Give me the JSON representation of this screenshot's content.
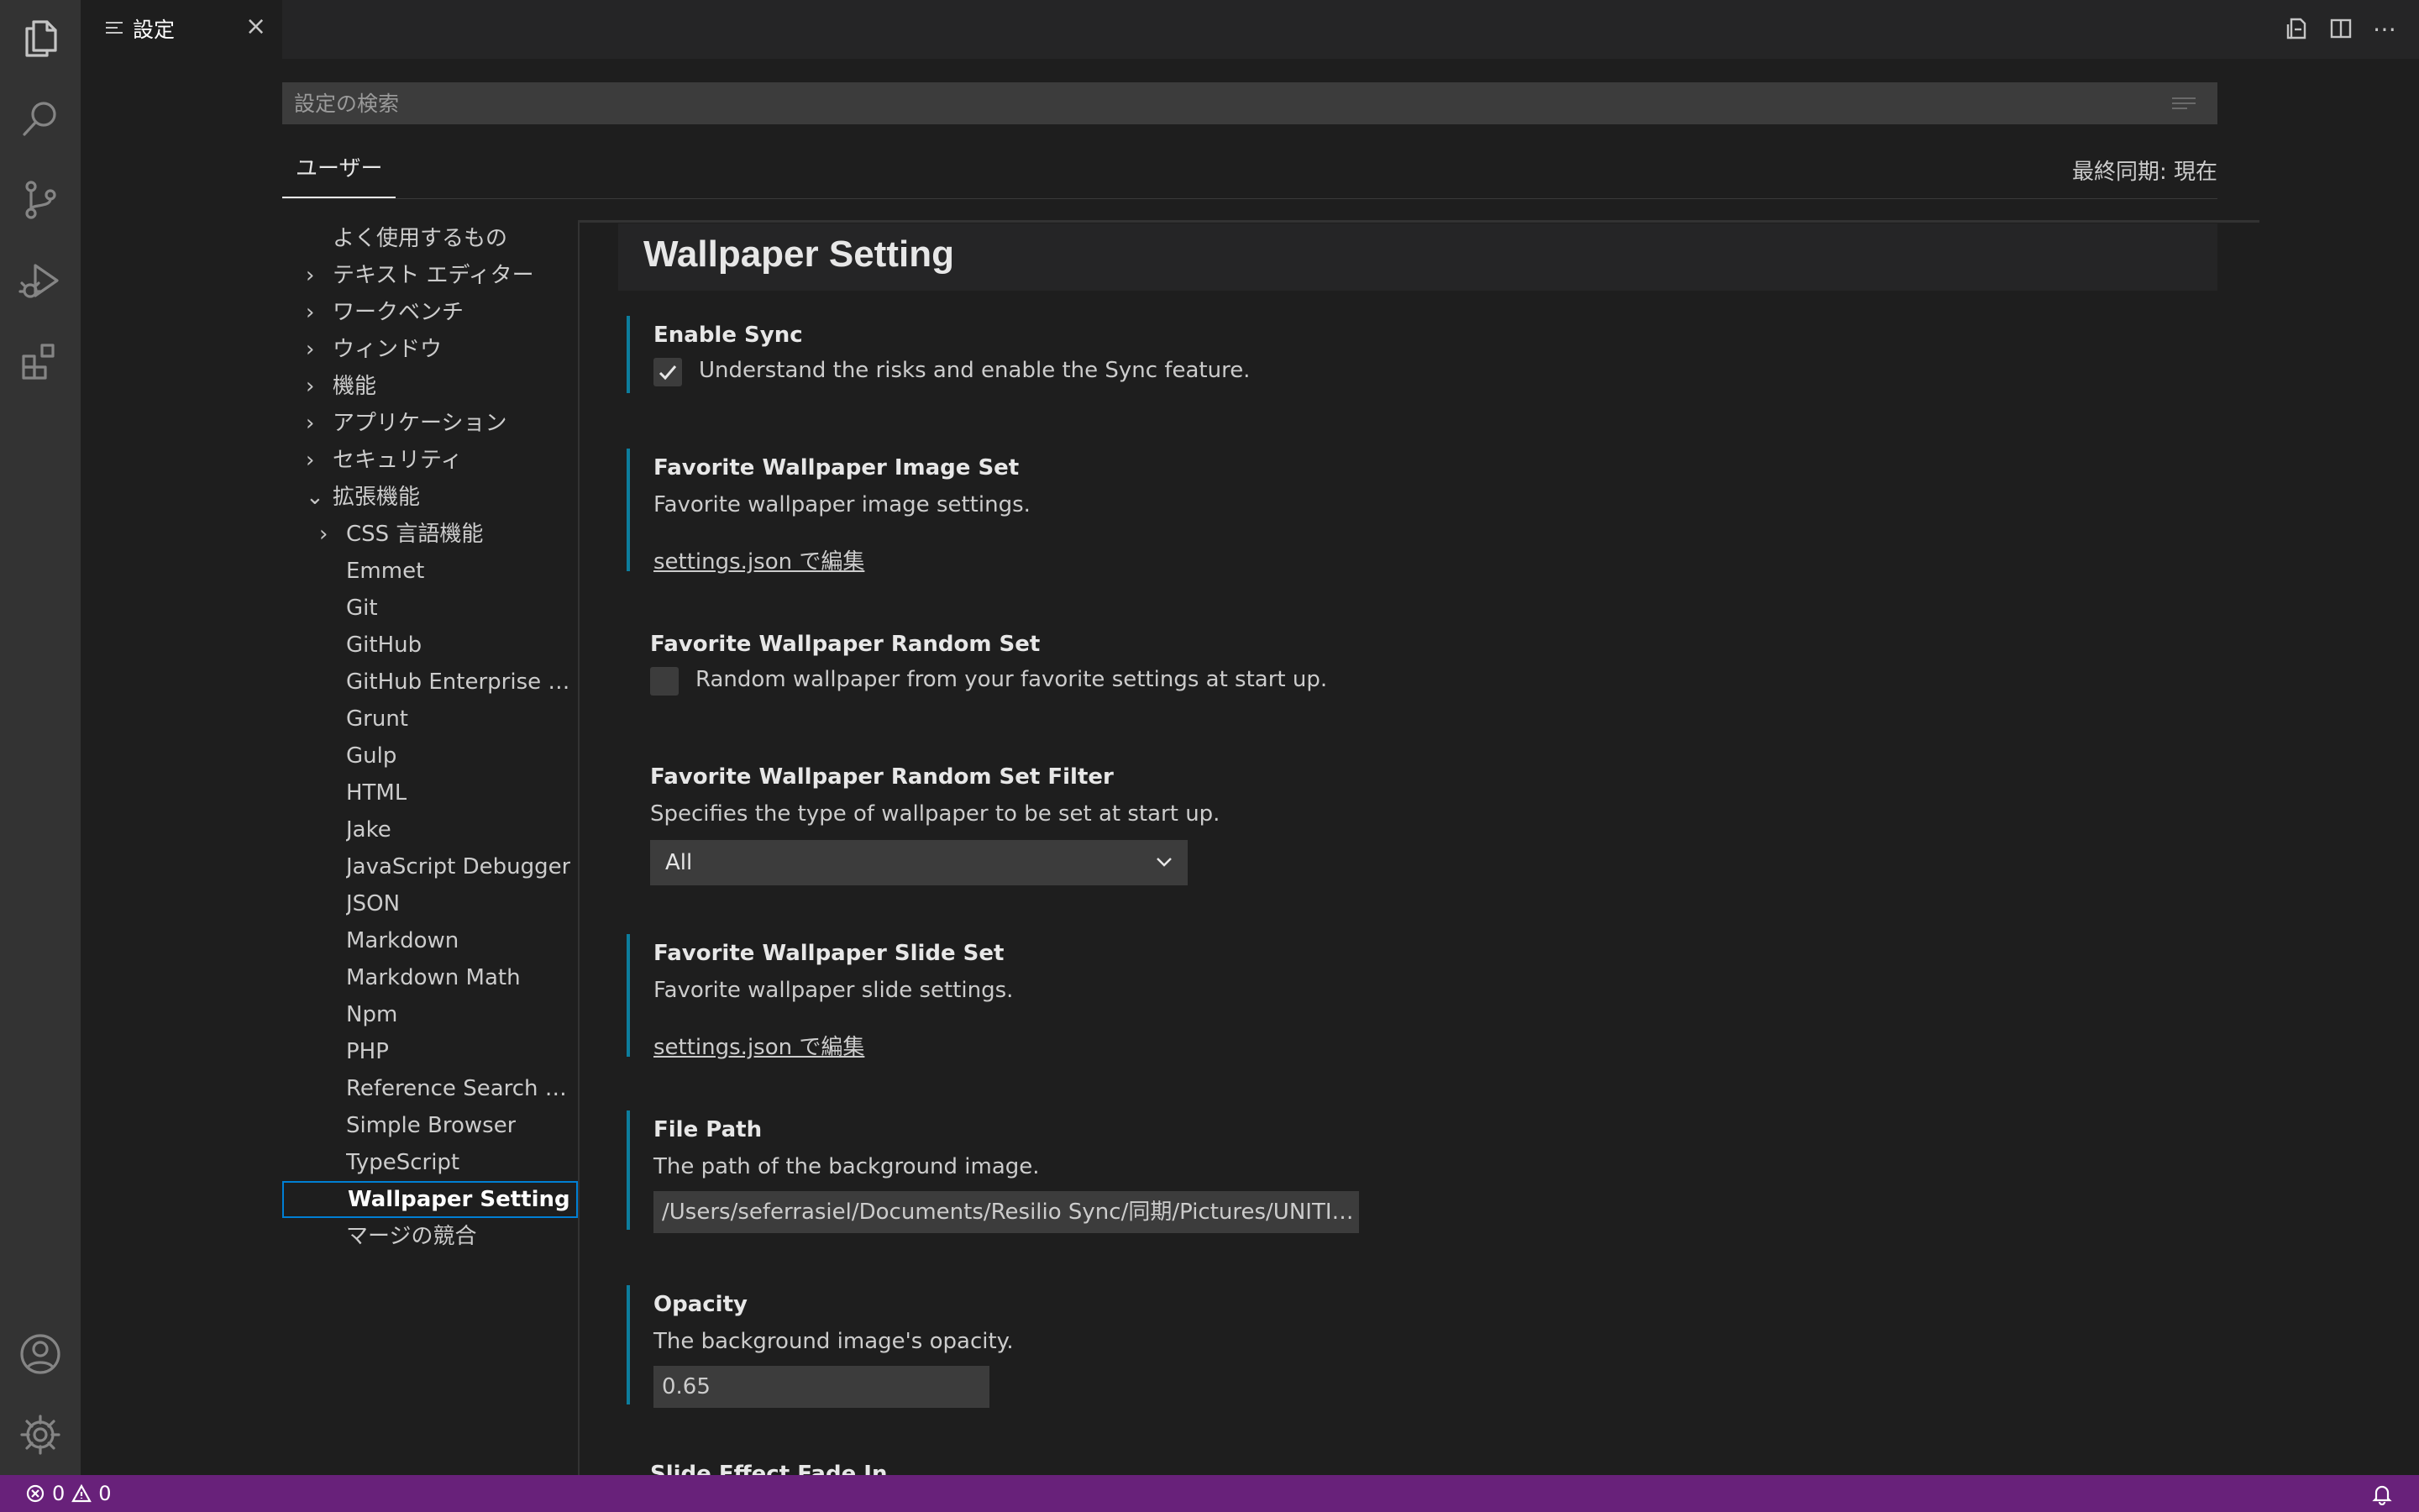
{
  "activity_bar": {
    "icons": [
      "explorer-icon",
      "search-icon",
      "source-control-icon",
      "run-debug-icon",
      "extensions-icon",
      "account-icon",
      "settings-gear-icon"
    ]
  },
  "tab": {
    "label": "設定",
    "close": "×"
  },
  "search": {
    "placeholder": "設定の検索"
  },
  "scope": {
    "user_tab": "ユーザー",
    "sync_status": "最終同期: 現在"
  },
  "toc": {
    "items": [
      {
        "label": "よく使用するもの",
        "chevron": ""
      },
      {
        "label": "テキスト エディター",
        "chevron": "›"
      },
      {
        "label": "ワークベンチ",
        "chevron": "›"
      },
      {
        "label": "ウィンドウ",
        "chevron": "›"
      },
      {
        "label": "機能",
        "chevron": "›"
      },
      {
        "label": "アプリケーション",
        "chevron": "›"
      },
      {
        "label": "セキュリティ",
        "chevron": "›"
      },
      {
        "label": "拡張機能",
        "chevron": "⌄"
      },
      {
        "label": "CSS 言語機能",
        "chevron": "›"
      },
      {
        "label": "Emmet",
        "chevron": ""
      },
      {
        "label": "Git",
        "chevron": ""
      },
      {
        "label": "GitHub",
        "chevron": ""
      },
      {
        "label": "GitHub Enterprise Au...",
        "chevron": ""
      },
      {
        "label": "Grunt",
        "chevron": ""
      },
      {
        "label": "Gulp",
        "chevron": ""
      },
      {
        "label": "HTML",
        "chevron": ""
      },
      {
        "label": "Jake",
        "chevron": ""
      },
      {
        "label": "JavaScript Debugger",
        "chevron": ""
      },
      {
        "label": "JSON",
        "chevron": ""
      },
      {
        "label": "Markdown",
        "chevron": ""
      },
      {
        "label": "Markdown Math",
        "chevron": ""
      },
      {
        "label": "Npm",
        "chevron": ""
      },
      {
        "label": "PHP",
        "chevron": ""
      },
      {
        "label": "Reference Search Vi...",
        "chevron": ""
      },
      {
        "label": "Simple Browser",
        "chevron": ""
      },
      {
        "label": "TypeScript",
        "chevron": ""
      },
      {
        "label": "Wallpaper Setting",
        "chevron": ""
      },
      {
        "label": "マージの競合",
        "chevron": ""
      }
    ]
  },
  "group": {
    "title": "Wallpaper Setting"
  },
  "settings": {
    "enable_sync": {
      "title": "Enable Sync",
      "checkbox_label": "Understand the risks and enable the Sync feature.",
      "checked": true
    },
    "image_set": {
      "title": "Favorite Wallpaper Image Set",
      "description": "Favorite wallpaper image settings.",
      "link": "settings.json で編集"
    },
    "random_set": {
      "title": "Favorite Wallpaper Random Set",
      "checkbox_label": "Random wallpaper from your favorite settings at start up.",
      "checked": false
    },
    "random_filter": {
      "title": "Favorite Wallpaper Random Set Filter",
      "description": "Specifies the type of wallpaper to be set at start up.",
      "value": "All"
    },
    "slide_set": {
      "title": "Favorite Wallpaper Slide Set",
      "description": "Favorite wallpaper slide settings.",
      "link": "settings.json で編集"
    },
    "file_path": {
      "title": "File Path",
      "description": "The path of the background image.",
      "value": "/Users/seferrasiel/Documents/Resilio Sync/同期/Pictures/UNITIA/..."
    },
    "opacity": {
      "title": "Opacity",
      "description": "The background image's opacity.",
      "value": "0.65"
    },
    "slide_fade": {
      "title": "Slide Effect Fade In"
    }
  },
  "status_bar": {
    "errors": "0",
    "warnings": "0"
  },
  "colors": {
    "status_bar": "#68217a",
    "modified_indicator": "#0c7d9d",
    "focus_border": "#007fd4"
  }
}
